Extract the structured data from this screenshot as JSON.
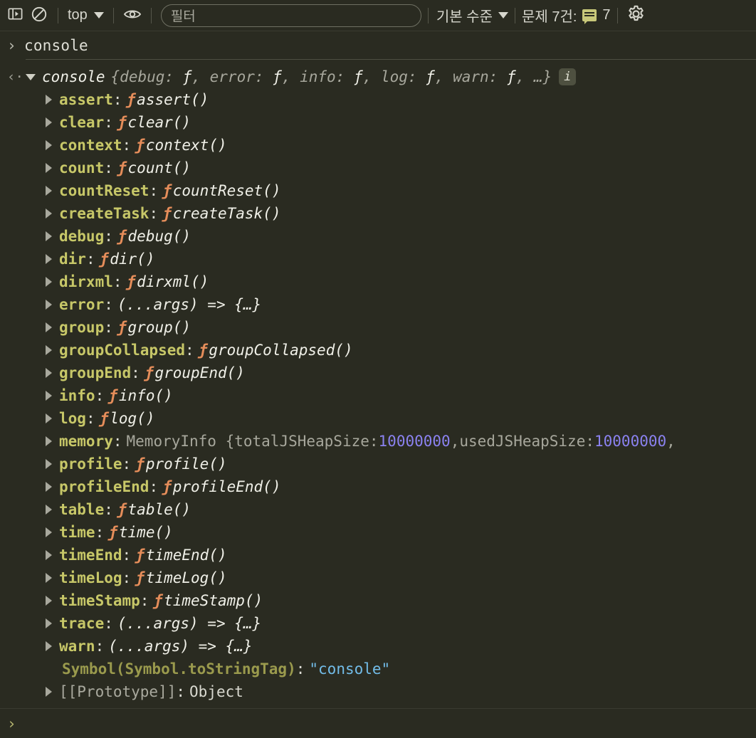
{
  "toolbar": {
    "icons": {
      "drawer": "panel-icon",
      "clear": "clear-console-icon",
      "eye": "live-expression-icon",
      "settings": "gear-icon"
    },
    "context_label": "top",
    "filter_placeholder": "필터",
    "filter_value": "",
    "level_label": "기본 수준",
    "issues_label": "문제 7건:",
    "issues_count": "7"
  },
  "console": {
    "command": "console",
    "prompt_chevron": "›",
    "return_arrow": "‹·",
    "bottom_prompt_chevron": "›"
  },
  "result": {
    "object_name": "console",
    "preview_open": "{",
    "preview_items": [
      {
        "key": "debug",
        "value": "ƒ"
      },
      {
        "key": "error",
        "value": "ƒ"
      },
      {
        "key": "info",
        "value": "ƒ"
      },
      {
        "key": "log",
        "value": "ƒ"
      },
      {
        "key": "warn",
        "value": "ƒ"
      }
    ],
    "preview_ellipsis": "…",
    "preview_close": "}",
    "info_badge": "i",
    "properties": [
      {
        "key": "assert",
        "kind": "fn",
        "sig": "assert()"
      },
      {
        "key": "clear",
        "kind": "fn",
        "sig": "clear()"
      },
      {
        "key": "context",
        "kind": "fn",
        "sig": "context()"
      },
      {
        "key": "count",
        "kind": "fn",
        "sig": "count()"
      },
      {
        "key": "countReset",
        "kind": "fn",
        "sig": "countReset()"
      },
      {
        "key": "createTask",
        "kind": "fn",
        "sig": "createTask()"
      },
      {
        "key": "debug",
        "kind": "fn",
        "sig": "debug()"
      },
      {
        "key": "dir",
        "kind": "fn",
        "sig": "dir()"
      },
      {
        "key": "dirxml",
        "kind": "fn",
        "sig": "dirxml()"
      },
      {
        "key": "error",
        "kind": "arrow",
        "sig": "(...args) => {…}"
      },
      {
        "key": "group",
        "kind": "fn",
        "sig": "group()"
      },
      {
        "key": "groupCollapsed",
        "kind": "fn",
        "sig": "groupCollapsed()"
      },
      {
        "key": "groupEnd",
        "kind": "fn",
        "sig": "groupEnd()"
      },
      {
        "key": "info",
        "kind": "fn",
        "sig": "info()"
      },
      {
        "key": "log",
        "kind": "fn",
        "sig": "log()"
      },
      {
        "key": "memory",
        "kind": "memory",
        "ctor": "MemoryInfo {",
        "entries": [
          {
            "name": "totalJSHeapSize: ",
            "num": "10000000",
            "sep": ", "
          },
          {
            "name": "usedJSHeapSize: ",
            "num": "10000000",
            "sep": ","
          }
        ]
      },
      {
        "key": "profile",
        "kind": "fn",
        "sig": "profile()"
      },
      {
        "key": "profileEnd",
        "kind": "fn",
        "sig": "profileEnd()"
      },
      {
        "key": "table",
        "kind": "fn",
        "sig": "table()"
      },
      {
        "key": "time",
        "kind": "fn",
        "sig": "time()"
      },
      {
        "key": "timeEnd",
        "kind": "fn",
        "sig": "timeEnd()"
      },
      {
        "key": "timeLog",
        "kind": "fn",
        "sig": "timeLog()"
      },
      {
        "key": "timeStamp",
        "kind": "fn",
        "sig": "timeStamp()"
      },
      {
        "key": "trace",
        "kind": "arrow",
        "sig": "(...args) => {…}"
      },
      {
        "key": "warn",
        "kind": "arrow",
        "sig": "(...args) => {…}"
      },
      {
        "key": "Symbol(Symbol.toStringTag)",
        "kind": "symbol",
        "sig": "\"console\""
      },
      {
        "key": "[[Prototype]]",
        "kind": "internal",
        "sig": "Object"
      }
    ]
  },
  "colors": {
    "background": "#2a2b21",
    "property_name": "#c7c768",
    "function_mark": "#e58d5a",
    "number": "#8b82f0",
    "string": "#72bce8",
    "symbol_key": "#9a9a4d",
    "issue_badge": "#c8c87a"
  }
}
